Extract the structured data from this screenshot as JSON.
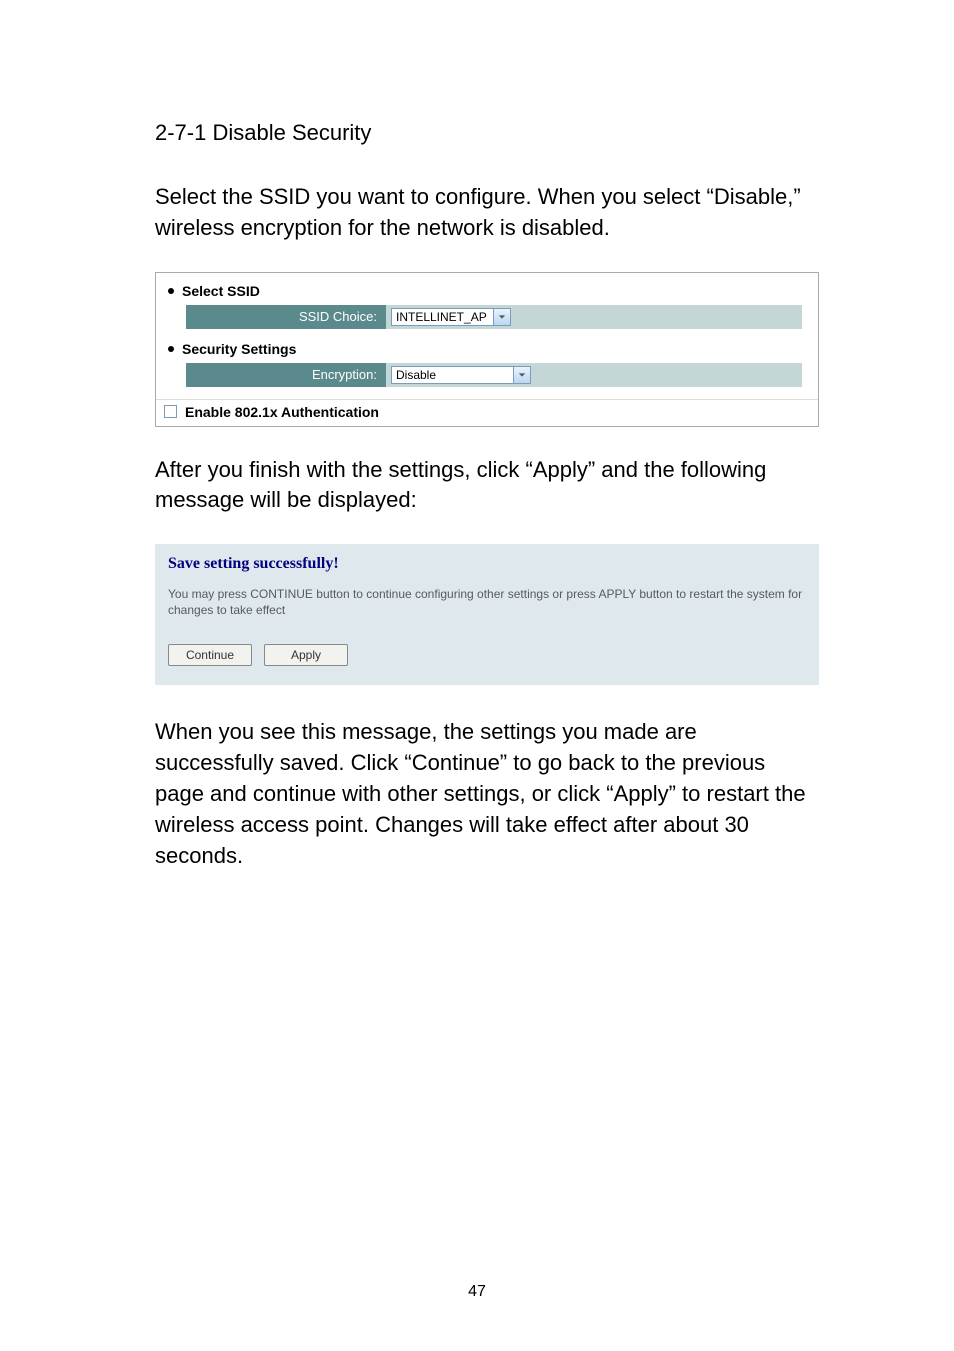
{
  "section_title": "2-7-1 Disable Security",
  "intro_text": "Select the SSID you want to configure. When you select “Disable,” wireless encryption for the network is disabled.",
  "panel1": {
    "select_ssid_label": "Select SSID",
    "ssid_choice_label": "SSID Choice:",
    "ssid_choice_value": "INTELLINET_AP",
    "security_settings_label": "Security Settings",
    "encryption_label": "Encryption:",
    "encryption_value": "Disable",
    "enable_8021x_label": "Enable 802.1x Authentication"
  },
  "after_text": "After you finish with the settings, click “Apply” and the following message will be displayed:",
  "save_panel": {
    "title": "Save setting successfully!",
    "body": "You may press CONTINUE button to continue configuring other settings or press APPLY button to restart the system for changes to take effect",
    "continue_label": "Continue",
    "apply_label": "Apply"
  },
  "final_text": "When you see this message, the settings you made are successfully saved. Click “Continue” to go back to the previous page and continue with other settings, or click “Apply” to restart the wireless access point. Changes will take effect after about 30 seconds.",
  "page_number": "47"
}
